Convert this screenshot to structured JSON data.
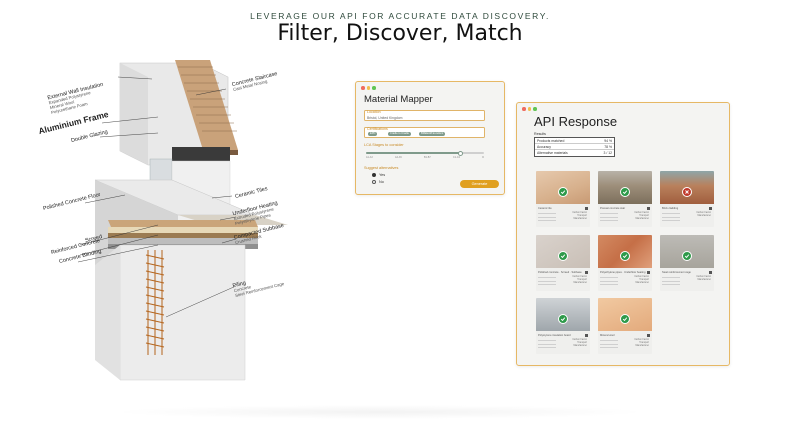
{
  "header": {
    "eyebrow": "LEVERAGE OUR API FOR ACCURATE DATA DISCOVERY.",
    "headline": "Filter, Discover, Match"
  },
  "diagram": {
    "labels": {
      "external_wall": {
        "title": "External Wall Insulation",
        "sub": [
          "Expanded Polystyrene",
          "Mineral Wool",
          "Polyurethane Foam"
        ]
      },
      "aluminium_frame": "Aluminium Frame",
      "double_glazing": "Double Glazing",
      "concrete_staircase": {
        "title": "Concrete Staircase",
        "sub": [
          "Cast Metal Nosing"
        ]
      },
      "polished_concrete_floor": "Polished Concrete Floor",
      "ceramic_tiles": "Ceramic Tiles",
      "underfloor_heating": {
        "title": "Underfloor Heating",
        "sub": [
          "Extruded Polystyrene",
          "Polyethylene Pipes"
        ]
      },
      "screed": "Screed",
      "reinforced_concrete": "Reinforced Concrete",
      "concrete_blinding": "Concrete Blinding",
      "compacted_subbase": {
        "title": "Compacted Subbase",
        "sub": [
          "Crushed Rock"
        ]
      },
      "piling": {
        "title": "Piling",
        "sub": [
          "Concrete",
          "Steel Reinforcement Cage"
        ]
      }
    }
  },
  "material_mapper": {
    "title": "Material Mapper",
    "location": {
      "label": "Location",
      "value": "Bristol, United Kingdom"
    },
    "certifications": {
      "label": "Certifications",
      "chips": [
        "EPD",
        "Cradle to Cradle",
        "BREEAM Excellent"
      ]
    },
    "lca_stages": {
      "label": "LCA Stages to consider",
      "ticks": [
        "A1-A3",
        "A4-A5",
        "B1-B7",
        "C1-C4",
        "D"
      ],
      "fill_fraction": 0.8
    },
    "suggest": {
      "label": "Suggest alternatives",
      "options": [
        "Yes",
        "No"
      ],
      "selected": "Yes"
    },
    "generate_label": "Generate"
  },
  "api_response": {
    "title": "API Response",
    "results_label": "Results",
    "results": [
      {
        "key": "Products matched",
        "value": "94 %"
      },
      {
        "key": "Accuracy",
        "value": "78 %"
      },
      {
        "key": "Alternative materials",
        "value": "3 / 12"
      }
    ],
    "cards": [
      {
        "name": "Ceramic tile",
        "status": "match",
        "meta": [
          "Carbon Factor",
          "Transport",
          "Manufacturer"
        ]
      },
      {
        "name": "Precast concrete stair",
        "status": "match",
        "meta": [
          "Carbon Factor",
          "Transport",
          "Manufacturer"
        ]
      },
      {
        "name": "Brick cladding",
        "status": "reject",
        "meta": [
          "Carbon Factor",
          "Manufacturer"
        ]
      },
      {
        "name": "Polished concrete · Screed · Subbase",
        "status": "match",
        "meta": [
          "Carbon Factor",
          "Transport",
          "Manufacturer"
        ]
      },
      {
        "name": "Polyethylene pipes · Underfloor heating",
        "status": "match",
        "meta": [
          "Carbon Factor",
          "Transport",
          "Manufacturer"
        ]
      },
      {
        "name": "Steel reinforcement cage",
        "status": "match",
        "meta": [
          "Carbon Factor",
          "Manufacturer"
        ]
      },
      {
        "name": "Polystyrene insulation board",
        "status": "match",
        "meta": [
          "Carbon Factor",
          "Transport",
          "Manufacturer"
        ]
      },
      {
        "name": "Mineral wool",
        "status": "match",
        "meta": [
          "Carbon Factor",
          "Transport",
          "Manufacturer"
        ]
      }
    ],
    "colors": {
      "match": "#2e9a4a",
      "reject": "#c0392b"
    }
  },
  "window_dots": {
    "red": "#ef6b5e",
    "yellow": "#f3bd4f",
    "green": "#5fc453"
  }
}
